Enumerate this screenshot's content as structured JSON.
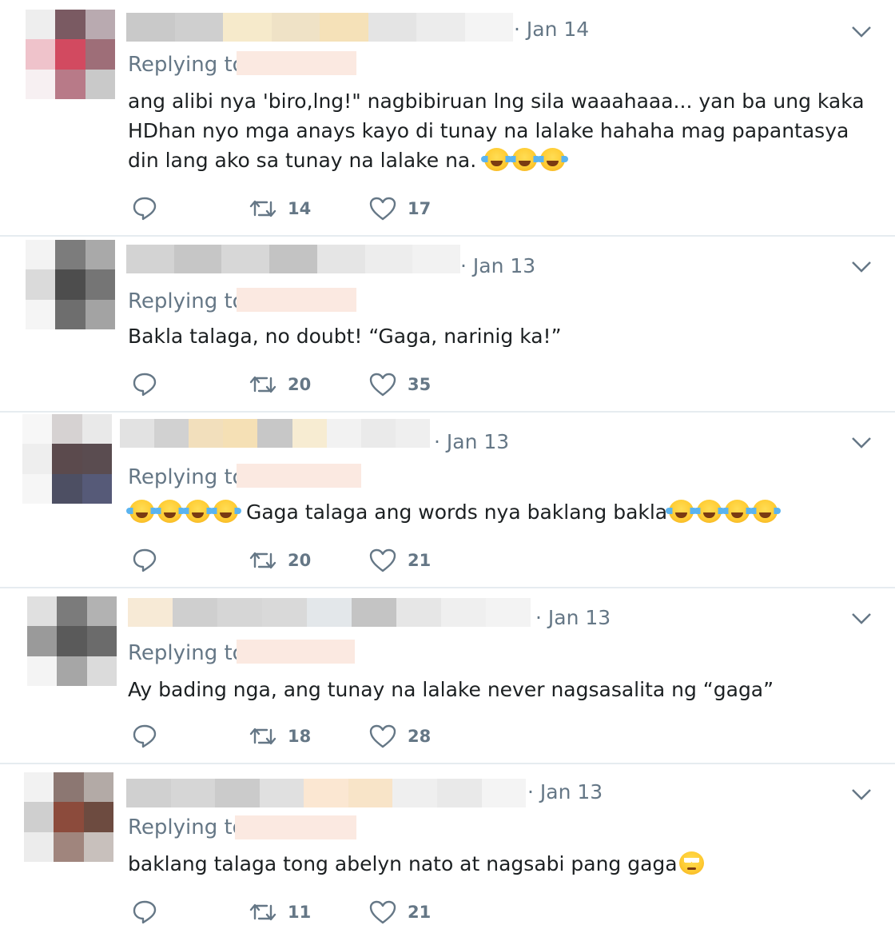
{
  "tweets": [
    {
      "date": "· Jan 14",
      "replying_label": "Replying to",
      "text_parts": [
        "ang alibi nya 'biro,lng!\" nagbibiruan lng sila waaahaaa... yan ba ung kaka HDhan nyo mga anays kayo di tunay na lalake hahaha mag papantasya din lang ako sa tunay na lalake na. "
      ],
      "emoji": [
        "face-with-tears-of-joy",
        "face-with-tears-of-joy",
        "face-with-tears-of-joy"
      ],
      "retweets": "14",
      "likes": "17"
    },
    {
      "date": "· Jan 13",
      "replying_label": "Replying to",
      "text_parts": [
        "Bakla talaga, no doubt!  “Gaga, narinig ka!”"
      ],
      "emoji": [],
      "retweets": "20",
      "likes": "35"
    },
    {
      "date": "· Jan 13",
      "replying_label": "Replying to",
      "text_parts": [
        " Gaga talaga ang words nya baklang bakla"
      ],
      "emoji": [
        "face-with-tears-of-joy"
      ],
      "retweets": "20",
      "likes": "21"
    },
    {
      "date": "· Jan 13",
      "replying_label": "Replying to",
      "text_parts": [
        "Ay bading nga, ang tunay na lalake never nagsasalita ng “gaga”"
      ],
      "emoji": [],
      "retweets": "18",
      "likes": "28"
    },
    {
      "date": "· Jan 13",
      "replying_label": "Replying to",
      "text_parts": [
        "baklang talaga tong abelyn nato at nagsabi pang gaga"
      ],
      "emoji": [
        "face-with-rolling-eyes"
      ],
      "retweets": "11",
      "likes": "21"
    }
  ],
  "colors": {
    "text": "#1c2022",
    "secondary": "#657786",
    "divider": "#e6ecf0",
    "redacted_handle": "#fbe9e1"
  }
}
